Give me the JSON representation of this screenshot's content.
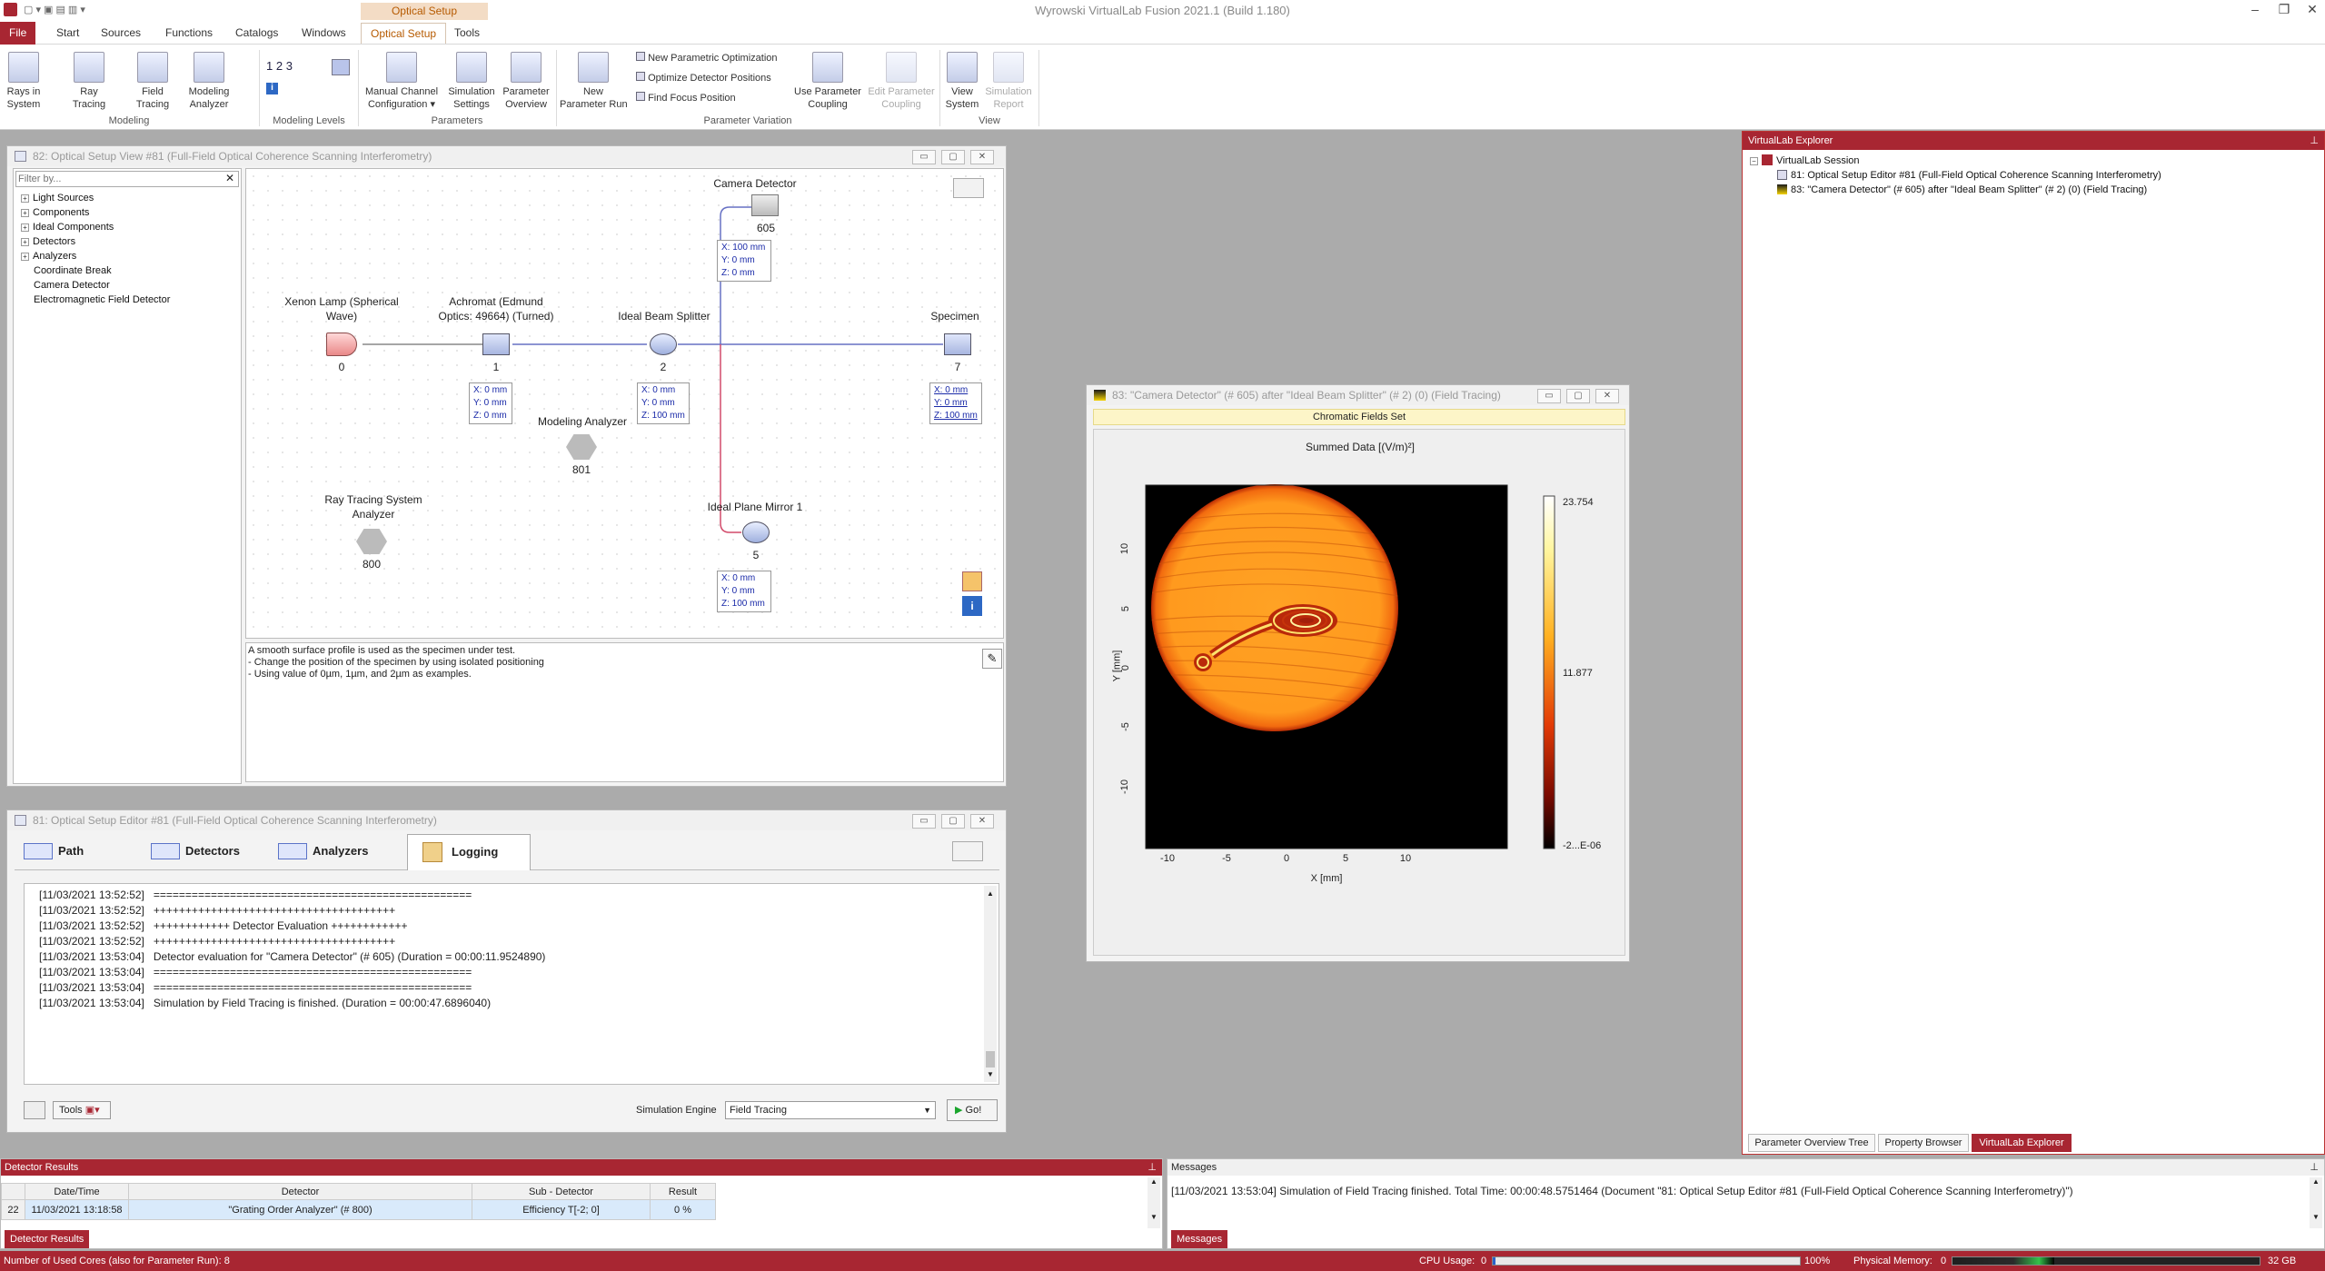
{
  "app": {
    "title": "Wyrowski VirtualLab Fusion 2021.1 (Build 1.180)",
    "context_tab_group": "Optical Setup"
  },
  "ribbon_tabs": [
    "File",
    "Start",
    "Sources",
    "Functions",
    "Catalogs",
    "Windows",
    "Optical Setup",
    "Tools"
  ],
  "ribbon": {
    "rays_in_system": "Rays in\nSystem",
    "ray_tracing": "Ray\nTracing",
    "field_tracing": "Field\nTracing",
    "modeling_analyzer": "Modeling\nAnalyzer",
    "group_modeling": "Modeling",
    "level_labels": [
      "1",
      "2",
      "3"
    ],
    "group_modeling_levels": "Modeling Levels",
    "manual_channel": "Manual Channel\nConfiguration ▾",
    "simulation_settings": "Simulation\nSettings",
    "parameter_overview": "Parameter\nOverview",
    "group_parameters": "Parameters",
    "new_parameter_run": "New\nParameter Run",
    "new_param_opt": "New Parametric Optimization",
    "optimize_detector": "Optimize Detector Positions",
    "find_focus": "Find Focus Position",
    "use_param_coupling": "Use Parameter\nCoupling",
    "edit_param_coupling": "Edit Parameter\nCoupling",
    "group_param_variation": "Parameter Variation",
    "view_system": "View\nSystem",
    "simulation_report": "Simulation\nReport",
    "group_view": "View"
  },
  "setup_view": {
    "title": "82: Optical Setup View #81 (Full-Field Optical Coherence Scanning Interferometry)",
    "filter_placeholder": "Filter by...",
    "tree": [
      "Light Sources",
      "Components",
      "Ideal Components",
      "Detectors",
      "Analyzers",
      "Coordinate Break",
      "Camera Detector",
      "Electromagnetic Field Detector"
    ],
    "nodes": {
      "lamp": {
        "label": "Xenon Lamp (Spherical\nWave)",
        "num": "0"
      },
      "achromat": {
        "label": "Achromat (Edmund\nOptics: 49664) (Turned)",
        "num": "1"
      },
      "splitter": {
        "label": "Ideal Beam Splitter",
        "num": "2"
      },
      "specimen": {
        "label": "Specimen",
        "num": "7"
      },
      "camera": {
        "label": "Camera Detector",
        "num": "605"
      },
      "modeling": {
        "label": "Modeling Analyzer",
        "num": "801"
      },
      "raytrace": {
        "label": "Ray Tracing System\nAnalyzer",
        "num": "800"
      },
      "mirror": {
        "label": "Ideal Plane Mirror 1",
        "num": "5"
      }
    },
    "coords": {
      "achromat": [
        "X: 0 mm",
        "Y: 0 mm",
        "Z: 0 mm"
      ],
      "splitter": [
        "X: 0 mm",
        "Y: 0 mm",
        "Z: 100 mm"
      ],
      "specimen": [
        "X: 0 mm",
        "Y: 0 mm",
        "Z: 100 mm"
      ],
      "camera": [
        "X: 100 mm",
        "Y: 0 mm",
        "Z: 0 mm"
      ],
      "mirror": [
        "X: 0 mm",
        "Y: 0 mm",
        "Z: 100 mm"
      ]
    },
    "description": [
      "A smooth surface profile is used as the specimen under test.",
      "- Change the position of the specimen by using isolated positioning",
      "- Using value of 0µm, 1µm, and 2µm as examples."
    ]
  },
  "editor": {
    "title": "81: Optical Setup Editor #81 (Full-Field Optical Coherence Scanning Interferometry)",
    "tabs": [
      "Path",
      "Detectors",
      "Analyzers",
      "Logging"
    ],
    "log": [
      "[11/03/2021 13:52:52]   ==================================================",
      "",
      "[11/03/2021 13:52:52]   ++++++++++++++++++++++++++++++++++++++",
      "[11/03/2021 13:52:52]   ++++++++++++ Detector Evaluation ++++++++++++",
      "[11/03/2021 13:52:52]   ++++++++++++++++++++++++++++++++++++++",
      "",
      "[11/03/2021 13:53:04]   Detector evaluation for \"Camera Detector\" (# 605) (Duration = 00:00:11.9524890)",
      "",
      "[11/03/2021 13:53:04]   ==================================================",
      "[11/03/2021 13:53:04]   ==================================================",
      "[11/03/2021 13:53:04]   Simulation by Field Tracing is finished. (Duration = 00:00:47.6896040)"
    ],
    "tools": "Tools",
    "sim_engine_label": "Simulation Engine",
    "sim_engine_value": "Field Tracing",
    "go": "Go!"
  },
  "result_window": {
    "title": "83: \"Camera Detector\" (# 605) after \"Ideal Beam Splitter\" (# 2) (0) (Field Tracing)",
    "header": "Chromatic Fields Set",
    "plot_title": "Summed Data  [(V/m)²]",
    "colorbar_max": "23.754",
    "colorbar_mid": "11.877",
    "colorbar_min": "-2...E-06",
    "xlabel": "X [mm]",
    "ylabel": "Y [mm]",
    "xticks": [
      "-10",
      "-5",
      "0",
      "5",
      "10"
    ],
    "yticks": [
      "10",
      "5",
      "0",
      "-5",
      "-10"
    ]
  },
  "explorer": {
    "title": "VirtualLab Explorer",
    "root": "VirtualLab Session",
    "items": [
      "81: Optical Setup Editor #81 (Full-Field Optical Coherence Scanning Interferometry)",
      "83: \"Camera Detector\" (# 605) after \"Ideal Beam Splitter\" (# 2) (0) (Field Tracing)"
    ],
    "bottom_tabs": [
      "Parameter Overview Tree",
      "Property Browser",
      "VirtualLab Explorer"
    ]
  },
  "detector_results": {
    "title": "Detector Results",
    "columns": [
      "Date/Time",
      "Detector",
      "Sub - Detector",
      "Result"
    ],
    "rows": [
      {
        "idx": "22",
        "date": "11/03/2021 13:18:58",
        "detector": "\"Grating Order Analyzer\" (# 800)",
        "sub": "Efficiency T[-2; 0]",
        "result": "0 %"
      }
    ],
    "tab": "Detector Results"
  },
  "messages": {
    "title": "Messages",
    "text": "[11/03/2021 13:53:04] Simulation of Field Tracing finished. Total Time: 00:00:48.5751464 (Document \"81: Optical Setup Editor #81 (Full-Field Optical Coherence Scanning Interferometry)\")",
    "tab": "Messages"
  },
  "statusbar": {
    "cores": "Number of Used Cores (also for Parameter Run): 8",
    "cpu_label": "CPU Usage:",
    "cpu_min": "0",
    "cpu_max": "100%",
    "cpu_level": 0.01,
    "mem_label": "Physical Memory:",
    "mem_min": "0",
    "mem_max": "32 GB",
    "mem_level": 0.33
  },
  "colors": {
    "accent": "#a82632",
    "ribbon_accent": "#b65a00",
    "link": "#1a2aa8"
  }
}
